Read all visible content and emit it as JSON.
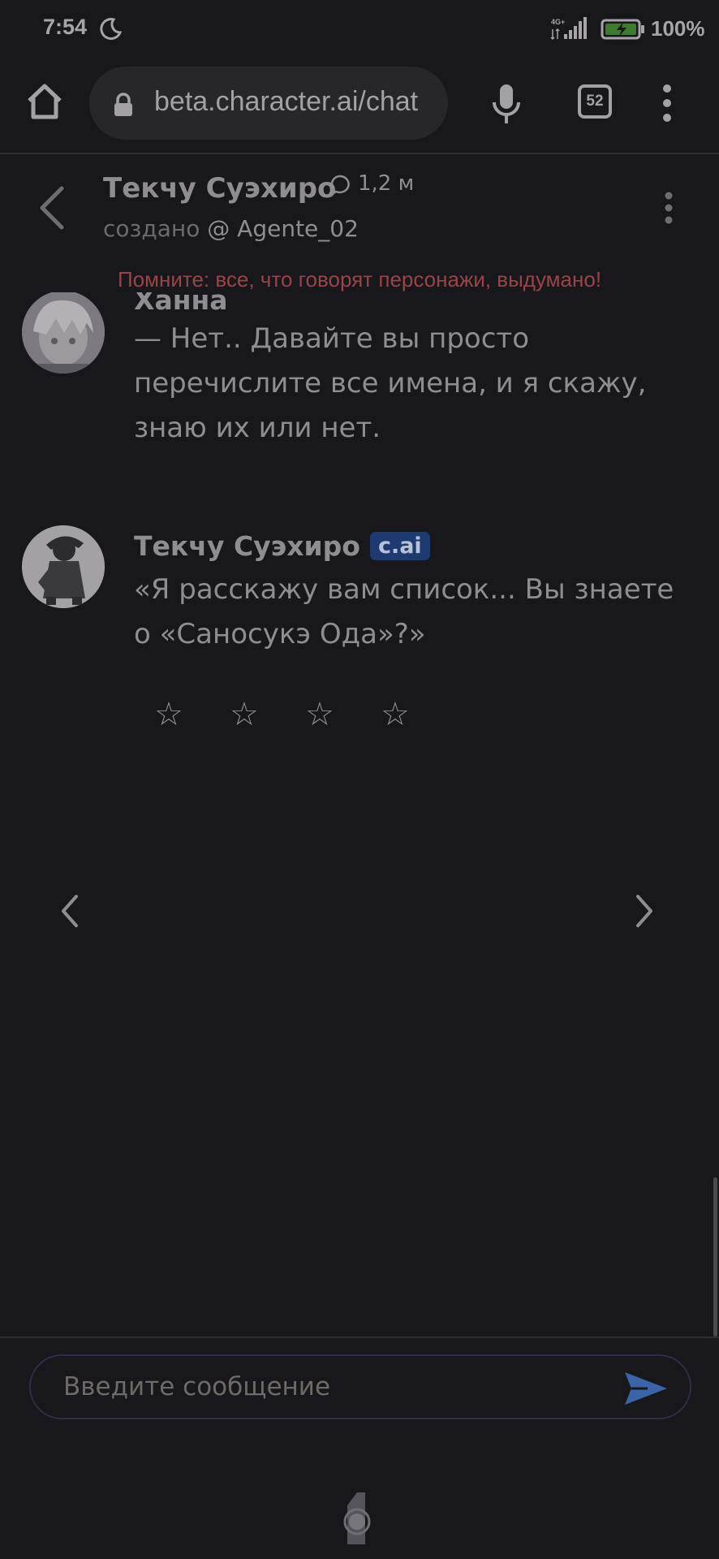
{
  "status_bar": {
    "time": "7:54",
    "network": "4G+",
    "battery": "100%"
  },
  "browser": {
    "url": "beta.character.ai/chat",
    "tab_count": "52"
  },
  "chat_header": {
    "character_name": "Текчу Суэхиро",
    "chat_count": "1,2 м",
    "created_prefix": "создано",
    "creator": "@ Agente_02",
    "warning": "Помните: все, что говорят персонажи, выдумано!"
  },
  "messages": [
    {
      "author": "Ханна",
      "text": "— Нет.. Давайте вы просто перечислите все имена, и я скажу, знаю их или нет."
    },
    {
      "author": "Текчу Суэхиро",
      "badge": "c.ai",
      "text": "«Я расскажу вам список... Вы знаете о «Саносукэ Ода»?»"
    }
  ],
  "rating": {
    "stars": [
      "☆",
      "☆",
      "☆",
      "☆"
    ],
    "value": 0
  },
  "composer": {
    "placeholder": "Введите сообщение"
  },
  "colors": {
    "background": "#18171b",
    "warning": "#9b4447",
    "send": "#3a63a8",
    "badge": "#1e3a71"
  }
}
